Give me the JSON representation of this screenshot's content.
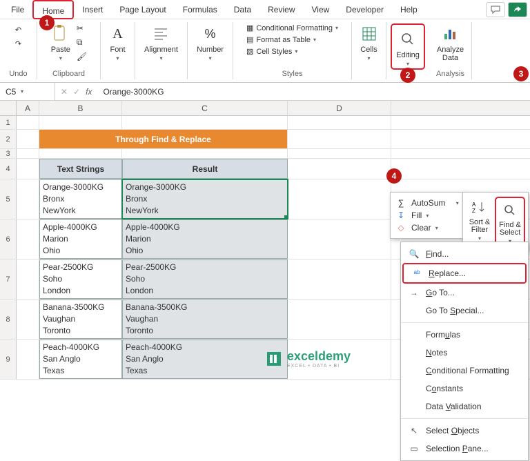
{
  "tabs": [
    "File",
    "Home",
    "Insert",
    "Page Layout",
    "Formulas",
    "Data",
    "Review",
    "View",
    "Developer",
    "Help"
  ],
  "active_tab": 1,
  "ribbon": {
    "undo_label": "Undo",
    "paste_label": "Paste",
    "clipboard_label": "Clipboard",
    "font_label": "Font",
    "alignment_label": "Alignment",
    "number_label": "Number",
    "cond_fmt": "Conditional Formatting",
    "fmt_table": "Format as Table",
    "cell_styles": "Cell Styles",
    "styles_label": "Styles",
    "cells_label": "Cells",
    "editing_label": "Editing",
    "analyze_label": "Analyze Data",
    "analysis_label": "Analysis"
  },
  "namebox": "C5",
  "formula": "Orange-3000KG",
  "columns": [
    "A",
    "B",
    "C",
    "D"
  ],
  "row_numbers": [
    "1",
    "2",
    "3",
    "4",
    "5",
    "6",
    "7",
    "8",
    "9"
  ],
  "title": "Through Find & Replace",
  "headers": {
    "b": "Text Strings",
    "c": "Result"
  },
  "rows": [
    {
      "b": [
        "Orange-3000KG",
        "Bronx",
        "NewYork"
      ],
      "c": [
        "Orange-3000KG",
        "Bronx",
        "NewYork"
      ]
    },
    {
      "b": [
        "Apple-4000KG",
        "Marion",
        "Ohio"
      ],
      "c": [
        "Apple-4000KG",
        "Marion",
        "Ohio"
      ]
    },
    {
      "b": [
        "Pear-2500KG",
        "Soho",
        "London"
      ],
      "c": [
        "Pear-2500KG",
        "Soho",
        "London"
      ]
    },
    {
      "b": [
        "Banana-3500KG",
        "Vaughan",
        "Toronto"
      ],
      "c": [
        "Banana-3500KG",
        "Vaughan",
        "Toronto"
      ]
    },
    {
      "b": [
        "Peach-4000KG",
        "San Anglo",
        "Texas"
      ],
      "c": [
        "Peach-4000KG",
        "San Anglo",
        "Texas"
      ]
    }
  ],
  "editing_panel": {
    "autosum": "AutoSum",
    "fill": "Fill",
    "clear": "Clear"
  },
  "sort_filter": "Sort & Filter",
  "find_select": "Find & Select",
  "menu": {
    "find": "Find...",
    "replace": "Replace...",
    "goto": "Go To...",
    "special": "Go To Special...",
    "formulas": "Formulas",
    "notes": "Notes",
    "cond": "Conditional Formatting",
    "constants": "Constants",
    "validation": "Data Validation",
    "sel_obj": "Select Objects",
    "sel_pane": "Selection Pane..."
  },
  "callouts": {
    "c1": "1",
    "c2": "2",
    "c3": "3",
    "c4": "4"
  },
  "watermark": {
    "brand": "exceldemy",
    "sub": "EXCEL • DATA • BI"
  }
}
